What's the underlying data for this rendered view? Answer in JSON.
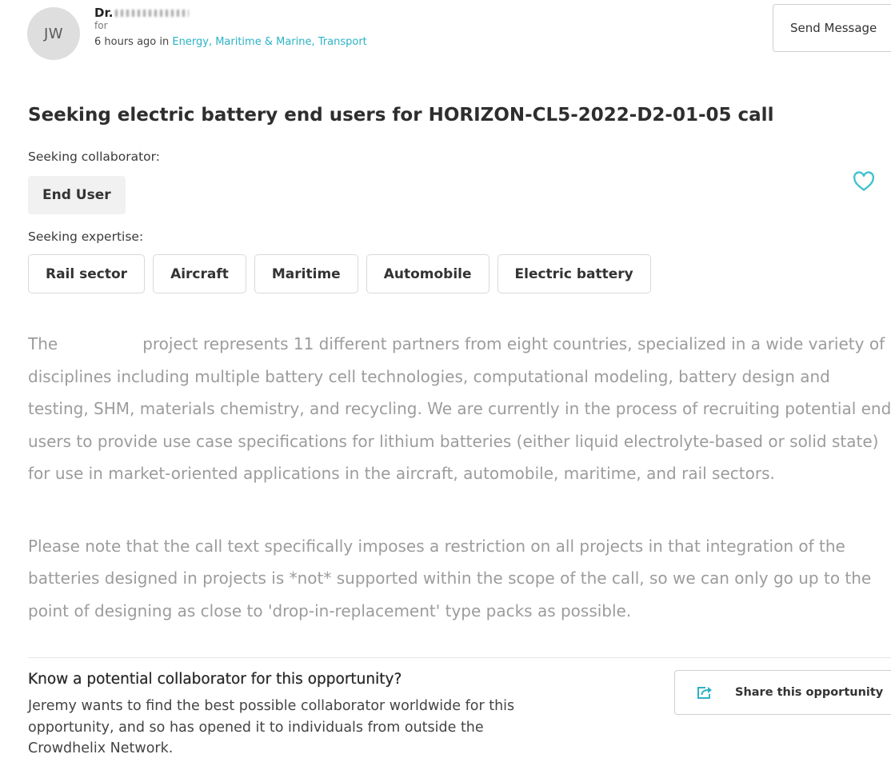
{
  "colors": {
    "accent": "#2bb3c5",
    "heart": "#3fc1cf",
    "title": "#2e2e2e",
    "tag_background": "#f1f1f1",
    "border": "#d9d9d9"
  },
  "author": {
    "initials": "JW",
    "name_prefix": "Dr.",
    "for_label": "for",
    "posted_prefix": "6 hours ago in",
    "categories": [
      "Energy",
      "Maritime & Marine",
      "Transport"
    ],
    "category_separator": ","
  },
  "actions": {
    "send_message_label": "Send Message",
    "favorite_icon": "heart-icon"
  },
  "opportunity": {
    "title": "Seeking electric battery end users for HORIZON-CL5-2022-D2-01-05 call",
    "collaborator_label": "Seeking collaborator:",
    "collaborator_tags": [
      "End User"
    ],
    "expertise_label": "Seeking expertise:",
    "expertise_tags": [
      "Rail sector",
      "Aircraft",
      "Maritime",
      "Automobile",
      "Electric battery"
    ]
  },
  "description": {
    "paragraph_1": {
      "line_1_before": "The",
      "line_1_after": "project represents 11 different partners from eight countries, specialized in a wide variety of",
      "lines": [
        "disciplines including multiple battery cell technologies, computational modeling, battery design and",
        "testing, SHM, materials chemistry, and recycling. We are currently in the process of recruiting potential end",
        "users to provide use case specifications for lithium batteries (either liquid electrolyte-based or solid state)",
        "for use in market-oriented applications in the aircraft, automobile, maritime, and rail sectors."
      ]
    },
    "paragraph_2": {
      "lines": [
        "Please note that the call text specifically imposes a restriction on all projects in that integration of the",
        "batteries designed in projects is *not* supported within the scope of the call, so we can only go up to the",
        "point of designing as close to 'drop-in-replacement' type packs as possible."
      ]
    }
  },
  "share": {
    "heading": "Know a potential collaborator for this opportunity?",
    "text": "Jeremy wants to find the best possible collaborator worldwide for this opportunity, and so has opened it to individuals from outside the Crowdhelix Network.",
    "button_label": "Share this opportunity",
    "button_icon": "share-icon"
  }
}
